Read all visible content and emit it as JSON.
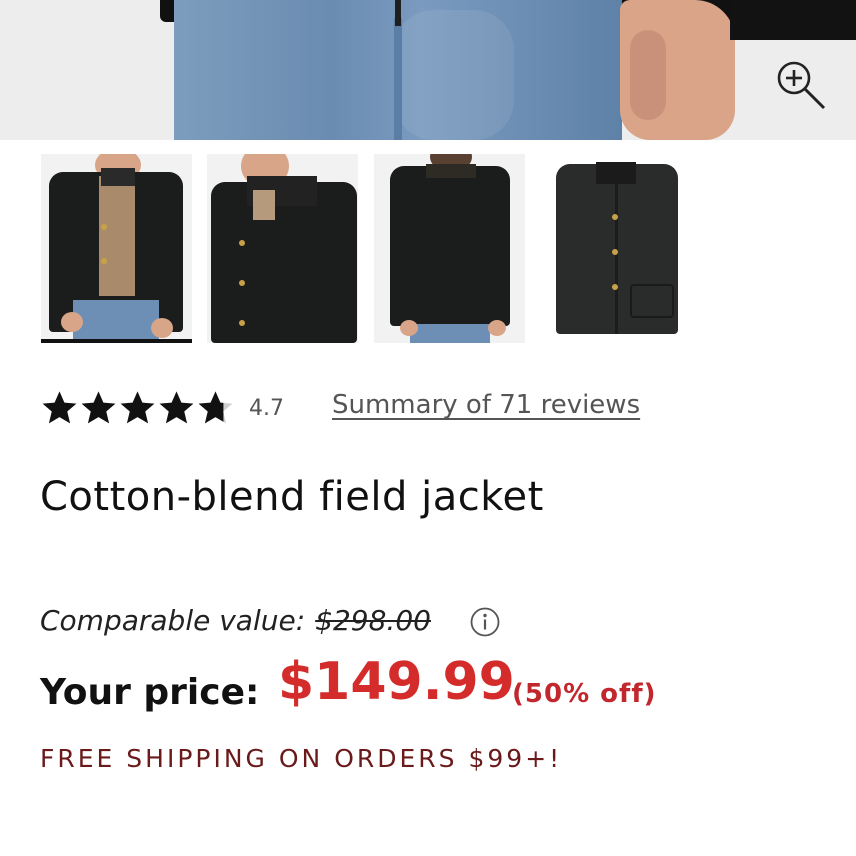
{
  "product": {
    "title": "Cotton-blend field jacket",
    "rating_value": "4.7",
    "rating_stars": 4.7,
    "reviews_link": "Summary of 71 reviews",
    "comparable_label": "Comparable value:",
    "comparable_price": "$298.00",
    "price_label": "Your price:",
    "price": "$149.99",
    "discount": "(50% off)",
    "shipping_banner": "FREE SHIPPING ON ORDERS $99+!"
  },
  "gallery": {
    "selected_index": 0,
    "thumbnails": [
      "front view",
      "side view",
      "back view",
      "flat lay"
    ]
  },
  "icons": {
    "zoom": "zoom-in-icon",
    "info": "info-icon",
    "star": "star-icon"
  },
  "colors": {
    "sale_red": "#d42b2b",
    "shipping_maroon": "#6a1a1a",
    "text_dark": "#111111",
    "muted": "#555555"
  }
}
